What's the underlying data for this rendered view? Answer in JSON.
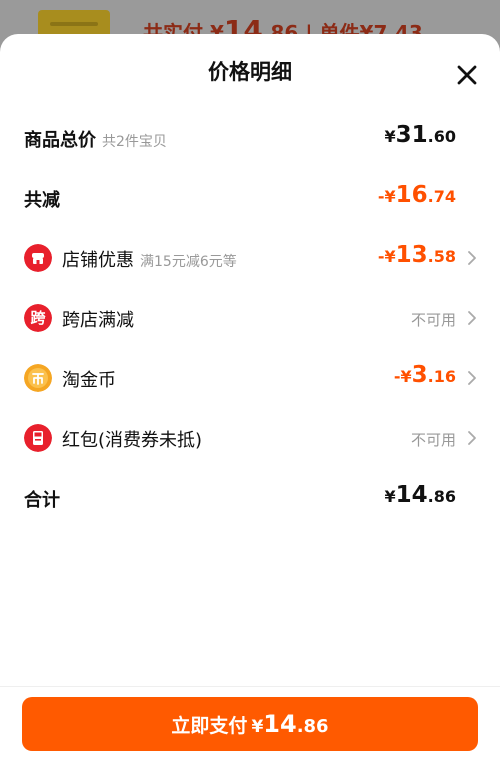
{
  "background_page": {
    "summary_prefix": "共实付",
    "currency": "¥",
    "amount_int": "14",
    "amount_dec": ".86",
    "divider": "|",
    "unit_price_text": "单件¥7.43"
  },
  "sheet": {
    "title": "价格明细"
  },
  "rows": {
    "total": {
      "label": "商品总价",
      "sub": "共2件宝贝",
      "currency": "¥",
      "int": "31",
      "dec": ".60"
    },
    "reduction": {
      "label": "共减",
      "currency": "-¥",
      "int": "16",
      "dec": ".74"
    },
    "shop_discount": {
      "label": "店铺优惠",
      "sub": "满15元减6元等",
      "currency": "-¥",
      "int": "13",
      "dec": ".58",
      "icon": "shop-icon"
    },
    "cross_shop": {
      "label": "跨店满减",
      "status": "不可用",
      "icon": "cross-shop-icon",
      "icon_text": "跨"
    },
    "coins": {
      "label": "淘金币",
      "currency": "-¥",
      "int": "3",
      "dec": ".16",
      "icon": "coin-icon"
    },
    "red_packet": {
      "label": "红包(消费券未抵)",
      "status": "不可用",
      "icon": "red-packet-icon"
    },
    "sum": {
      "label": "合计",
      "currency": "¥",
      "int": "14",
      "dec": ".86"
    }
  },
  "pay_button": {
    "label": "立即支付",
    "currency": "¥",
    "int": "14",
    "dec": ".86"
  },
  "colors": {
    "accent": "#ff5000",
    "button": "#ff5a00",
    "icon_red": "#e8202c",
    "icon_gold": "#f5a623"
  }
}
